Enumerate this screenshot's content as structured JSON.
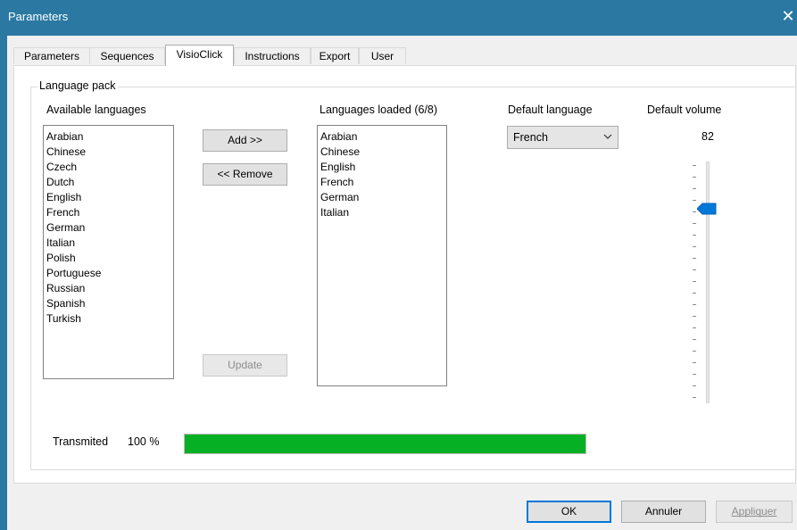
{
  "window": {
    "title": "Parameters",
    "close_glyph": "✕"
  },
  "tabs": [
    "Parameters",
    "Sequences",
    "VisioClick",
    "Instructions",
    "Export",
    "User"
  ],
  "active_tab": "VisioClick",
  "language_pack": {
    "group_title": "Language pack",
    "available_label": "Available languages",
    "available": [
      "Arabian",
      "Chinese",
      "Czech",
      "Dutch",
      "English",
      "French",
      "German",
      "Italian",
      "Polish",
      "Portuguese",
      "Russian",
      "Spanish",
      "Turkish"
    ],
    "add_label": "Add >>",
    "remove_label": "<< Remove",
    "update_label": "Update",
    "loaded_label": "Languages loaded (6/8)",
    "loaded": [
      "Arabian",
      "Chinese",
      "English",
      "French",
      "German",
      "Italian"
    ],
    "default_language_label": "Default language",
    "default_language_value": "French",
    "default_volume_label": "Default volume",
    "default_volume_value": "82",
    "volume_level": 82,
    "transmitted_label": "Transmited",
    "transmitted_percent": "100 %",
    "progress_fraction": 1.0,
    "progress_color": "#06b025"
  },
  "buttons": {
    "ok": "OK",
    "cancel": "Annuler",
    "apply": "Appliquer"
  },
  "colors": {
    "titlebar": "#2b79a3",
    "accent": "#0078d7"
  },
  "icons": {
    "close": "close-icon",
    "dropdown": "chevron-down-icon",
    "slider_thumb": "slider-thumb-icon"
  }
}
